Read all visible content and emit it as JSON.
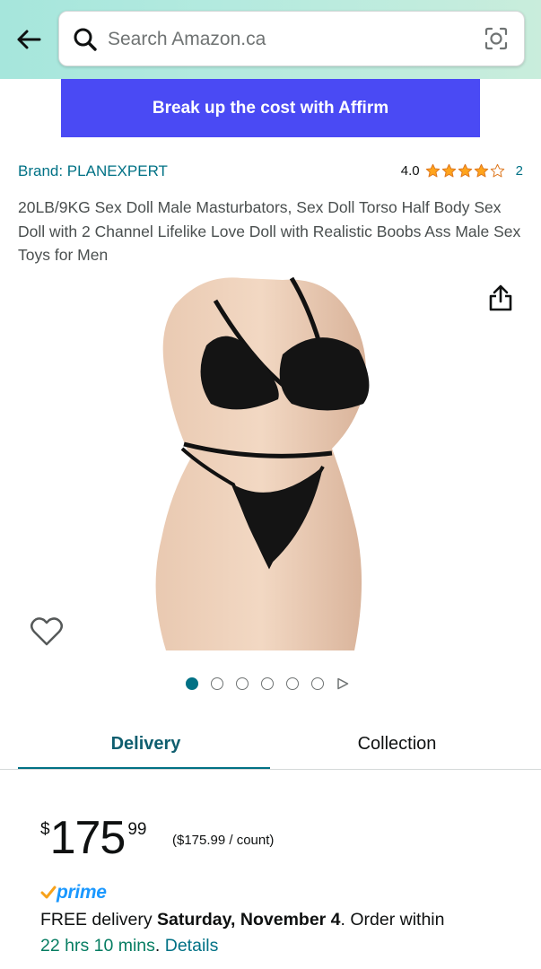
{
  "header": {
    "search_placeholder": "Search Amazon.ca",
    "icons": {
      "back": "back-arrow-icon",
      "search": "search-icon",
      "lens": "camera-lens-icon"
    },
    "colors": {
      "gradient_start": "#a6e6dc",
      "gradient_end": "#c9eddc"
    }
  },
  "affirm": {
    "label": "Break up the cost with Affirm",
    "color": "#4a4af4"
  },
  "brand": {
    "label": "Brand: PLANEXPERT"
  },
  "rating": {
    "value": "4.0",
    "stars": 4,
    "count": "2",
    "star_color": "#ffa41c"
  },
  "product": {
    "title": "20LB/9KG Sex Doll Male Masturbators, Sex Doll Torso Half Body Sex Doll with 2 Channel Lifelike Love Doll with Realistic Boobs Ass Male Sex Toys for Men"
  },
  "gallery": {
    "image_count": 6,
    "active_index": 0,
    "has_video": true,
    "icons": {
      "share": "share-icon",
      "wishlist": "heart-icon",
      "video": "play-icon"
    }
  },
  "tabs": [
    {
      "label": "Delivery",
      "active": true
    },
    {
      "label": "Collection",
      "active": false
    }
  ],
  "price": {
    "symbol": "$",
    "whole": "175",
    "fraction": "99",
    "unit": "($175.99 / count)"
  },
  "prime": {
    "label": "prime",
    "color": "#1a98ff"
  },
  "delivery": {
    "prefix": "FREE delivery ",
    "date": "Saturday, November 4",
    "suffix": ". Order within",
    "countdown": "22 hrs 10 mins",
    "separator": ". ",
    "details_label": "Details"
  },
  "colors": {
    "link": "#007185",
    "countdown": "#067d62"
  }
}
